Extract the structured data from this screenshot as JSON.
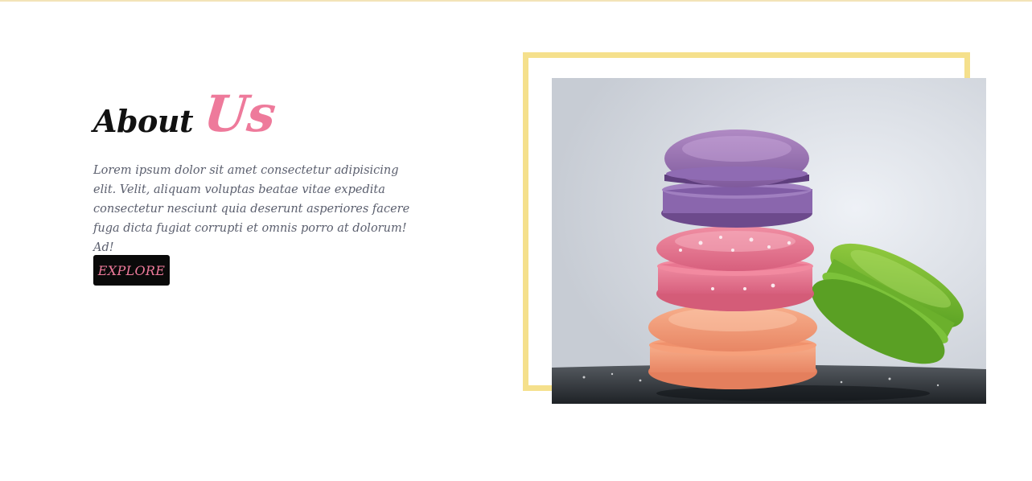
{
  "about": {
    "heading_main": "About",
    "heading_accent": "Us",
    "description": "Lorem ipsum dolor sit amet consectetur adipisicing elit. Velit, aliquam voluptas beatae vitae expedita consectetur nesciunt quia deserunt asperiores facere fuga dicta fugiat corrupti et omnis porro at dolorum! Ad!",
    "button_label": "EXPLORE"
  },
  "image": {
    "subject": "stack of colorful macarons (purple, pink, peach, green)"
  },
  "colors": {
    "accent_pink": "#ee7a9b",
    "frame_yellow": "#f5e08c",
    "button_bg": "#0a0a0a",
    "text_gray": "#5b5f6e",
    "heading_dark": "#111111"
  }
}
